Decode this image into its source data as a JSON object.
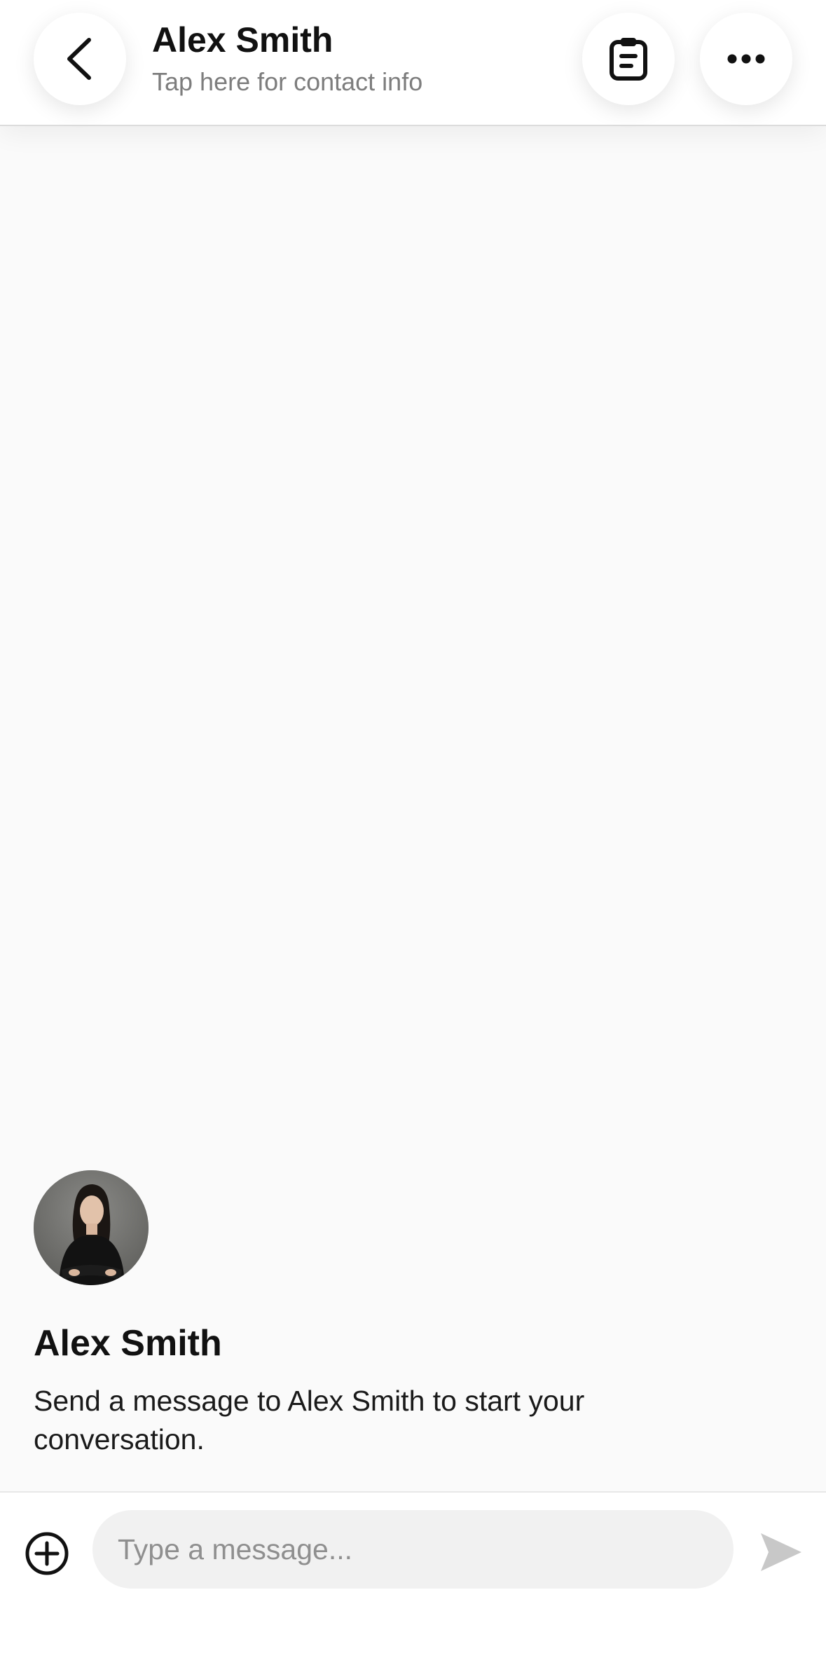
{
  "header": {
    "contact_name": "Alex Smith",
    "subtitle": "Tap here for contact info",
    "icons": {
      "back": "chevron-left-icon",
      "clipboard": "clipboard-icon",
      "more": "more-horizontal-icon"
    }
  },
  "intro": {
    "name": "Alex Smith",
    "message": "Send a message to Alex Smith to start your conversation."
  },
  "composer": {
    "placeholder": "Type a message...",
    "value": "",
    "icons": {
      "attach": "plus-circle-icon",
      "send": "send-icon"
    }
  },
  "colors": {
    "background": "#fafafa",
    "header": "#ffffff",
    "text_primary": "#111111",
    "text_secondary": "#7d7d7d",
    "input_background": "#f1f1f1",
    "send_disabled": "#c8c8c8"
  }
}
